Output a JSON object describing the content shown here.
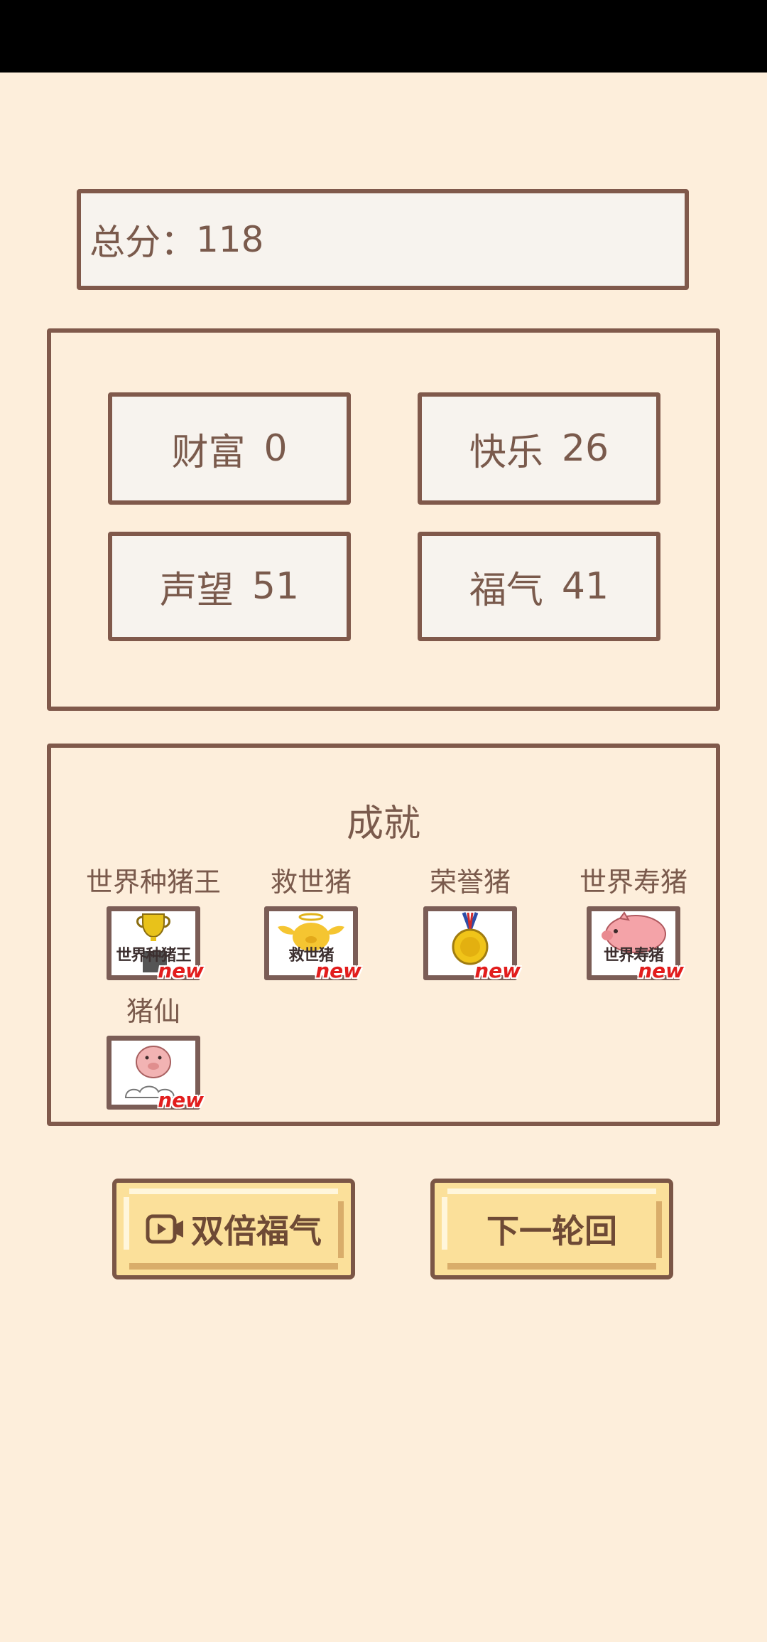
{
  "total": {
    "label": "总分：",
    "value": "118"
  },
  "stats": [
    {
      "label": "财富",
      "value": "0"
    },
    {
      "label": "快乐",
      "value": "26"
    },
    {
      "label": "声望",
      "value": "51"
    },
    {
      "label": "福气",
      "value": "41"
    }
  ],
  "achievements": {
    "title": "成就",
    "items": [
      {
        "name": "世界种猪王",
        "badge_text": "世界种猪王",
        "icon": "trophy-icon",
        "tag": "new"
      },
      {
        "name": "救世猪",
        "badge_text": "救世猪",
        "icon": "angel-pig-icon",
        "tag": "new"
      },
      {
        "name": "荣誉猪",
        "badge_text": "",
        "icon": "medal-icon",
        "tag": "new"
      },
      {
        "name": "世界寿猪",
        "badge_text": "世界寿猪",
        "icon": "pink-pig-icon",
        "tag": "new"
      },
      {
        "name": "猪仙",
        "badge_text": "",
        "icon": "cloud-pig-icon",
        "tag": "new"
      }
    ]
  },
  "buttons": {
    "double_label": "双倍福气",
    "double_icon": "video-icon",
    "next_label": "下一轮回"
  },
  "colors": {
    "background": "#fdeedb",
    "border": "#80594b",
    "text": "#7a5a4c",
    "button_fill": "#fbe09a",
    "new_tag": "#e21d1d"
  }
}
